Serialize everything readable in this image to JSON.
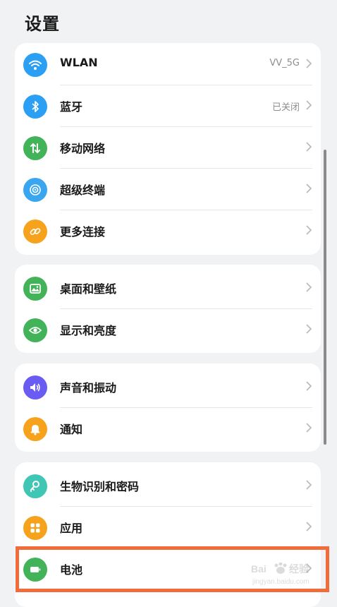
{
  "header": {
    "title": "设置"
  },
  "colors": {
    "wlan": "#2b9ff4",
    "bluetooth": "#2b9ff4",
    "mobile": "#42b359",
    "super_device": "#3ba6f0",
    "more_connect": "#f7a21c",
    "wallpaper": "#42b359",
    "display": "#42b359",
    "sound": "#6a5cf2",
    "notify": "#f7a21c",
    "biometrics": "#3fc6b4",
    "apps": "#f7a21c",
    "battery": "#42b359",
    "highlight": "#f26b3a"
  },
  "groups": [
    {
      "items": [
        {
          "label": "WLAN",
          "value": "VV_5G",
          "icon": "wifi-icon"
        },
        {
          "label": "蓝牙",
          "value": "已关闭",
          "icon": "bluetooth-icon"
        },
        {
          "label": "移动网络",
          "value": "",
          "icon": "mobile-data-icon"
        },
        {
          "label": "超级终端",
          "value": "",
          "icon": "super-device-icon"
        },
        {
          "label": "更多连接",
          "value": "",
          "icon": "link-icon"
        }
      ]
    },
    {
      "items": [
        {
          "label": "桌面和壁纸",
          "value": "",
          "icon": "wallpaper-icon"
        },
        {
          "label": "显示和亮度",
          "value": "",
          "icon": "eye-icon"
        }
      ]
    },
    {
      "items": [
        {
          "label": "声音和振动",
          "value": "",
          "icon": "speaker-icon"
        },
        {
          "label": "通知",
          "value": "",
          "icon": "bell-icon"
        }
      ]
    },
    {
      "items": [
        {
          "label": "生物识别和密码",
          "value": "",
          "icon": "key-icon"
        },
        {
          "label": "应用",
          "value": "",
          "icon": "apps-icon"
        },
        {
          "label": "电池",
          "value": "",
          "icon": "battery-icon"
        }
      ]
    }
  ],
  "watermark": {
    "brand": "Bai 经验",
    "url": "jingyan.baidu.com"
  }
}
